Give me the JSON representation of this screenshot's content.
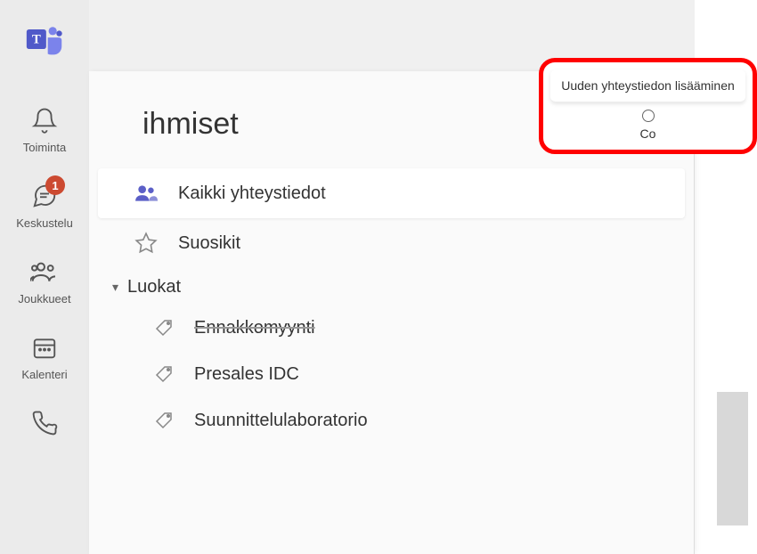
{
  "app_rail": {
    "items": [
      {
        "label": "Toiminta"
      },
      {
        "label": "Keskustelu",
        "badge": "1"
      },
      {
        "label": "Joukkueet"
      },
      {
        "label": "Kalenteri"
      }
    ]
  },
  "panel": {
    "title": "ihmiset",
    "all_contacts": "Kaikki yhteystiedot",
    "favorites": "Suosikit",
    "categories_header": "Luokat",
    "categories": [
      {
        "label": "Ennakkomyynti"
      },
      {
        "label": "Presales IDC"
      },
      {
        "label": "Suunnittelulaboratorio"
      }
    ]
  },
  "tooltip": {
    "title": "Uuden yhteystiedon lisääminen",
    "sub": "Co"
  }
}
